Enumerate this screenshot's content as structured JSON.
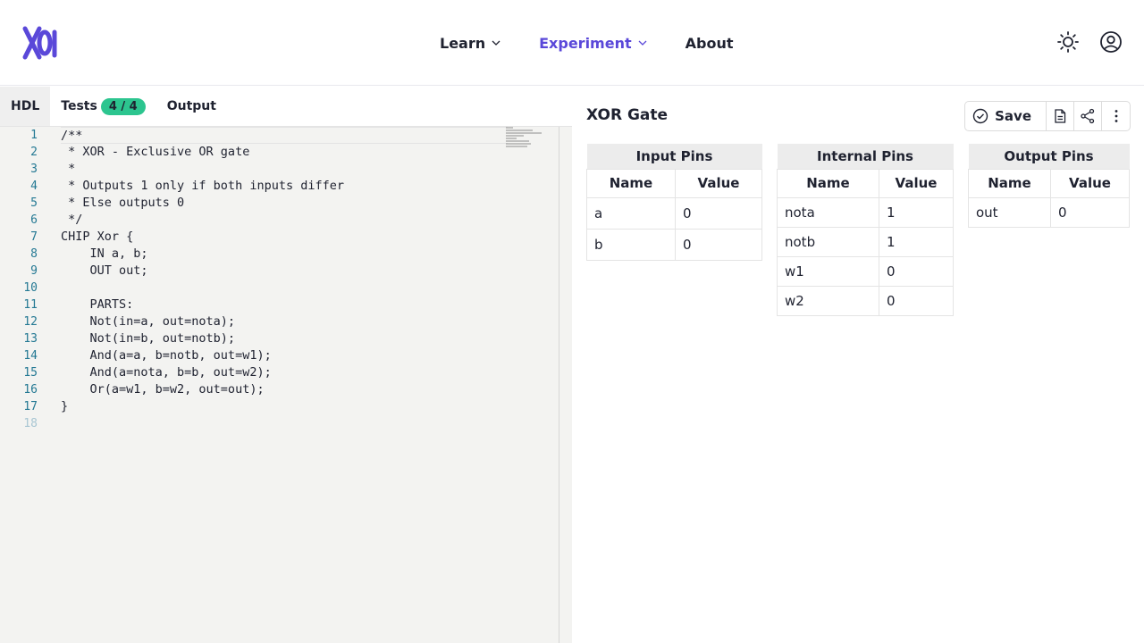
{
  "header": {
    "logo_icon": "nand2tetris-logo-icon",
    "nav": [
      {
        "label": "Learn",
        "has_menu": true,
        "active": false
      },
      {
        "label": "Experiment",
        "has_menu": true,
        "active": true
      },
      {
        "label": "About",
        "has_menu": false,
        "active": false
      }
    ],
    "icons": [
      "sun-icon",
      "user-icon"
    ]
  },
  "left_panel": {
    "tabs": [
      {
        "label": "HDL",
        "active": true
      },
      {
        "label": "Tests",
        "badge": "4 / 4",
        "active": false
      },
      {
        "label": "Output",
        "active": false
      }
    ],
    "editor": {
      "line_numbers": [
        "1",
        "2",
        "3",
        "4",
        "5",
        "6",
        "7",
        "8",
        "9",
        "10",
        "11",
        "12",
        "13",
        "14",
        "15",
        "16",
        "17",
        "18"
      ],
      "lines": [
        "/**",
        " * XOR - Exclusive OR gate",
        " *",
        " * Outputs 1 only if both inputs differ",
        " * Else outputs 0",
        " */",
        "CHIP Xor {",
        "    IN a, b;",
        "    OUT out;",
        "",
        "    PARTS:",
        "    Not(in=a, out=nota);",
        "    Not(in=b, out=notb);",
        "    And(a=a, b=notb, out=w1);",
        "    And(a=nota, b=b, out=w2);",
        "    Or(a=w1, b=w2, out=out);",
        "}",
        ""
      ]
    }
  },
  "right_panel": {
    "title": "XOR Gate",
    "actions": {
      "save_label": "Save",
      "icons": [
        "check-circle-icon",
        "file-icon",
        "share-icon",
        "more-vertical-icon"
      ]
    },
    "input_pins": {
      "title": "Input Pins",
      "headers": [
        "Name",
        "Value"
      ],
      "rows": [
        [
          "a",
          "0"
        ],
        [
          "b",
          "0"
        ]
      ]
    },
    "internal_pins": {
      "title": "Internal Pins",
      "headers": [
        "Name",
        "Value"
      ],
      "rows": [
        [
          "nota",
          "1"
        ],
        [
          "notb",
          "1"
        ],
        [
          "w1",
          "0"
        ],
        [
          "w2",
          "0"
        ]
      ]
    },
    "output_pins": {
      "title": "Output Pins",
      "headers": [
        "Name",
        "Value"
      ],
      "rows": [
        [
          "out",
          "0"
        ]
      ]
    }
  },
  "colors": {
    "accent": "#5a48d9",
    "badge": "#2cc58f",
    "line_number": "#237893"
  }
}
